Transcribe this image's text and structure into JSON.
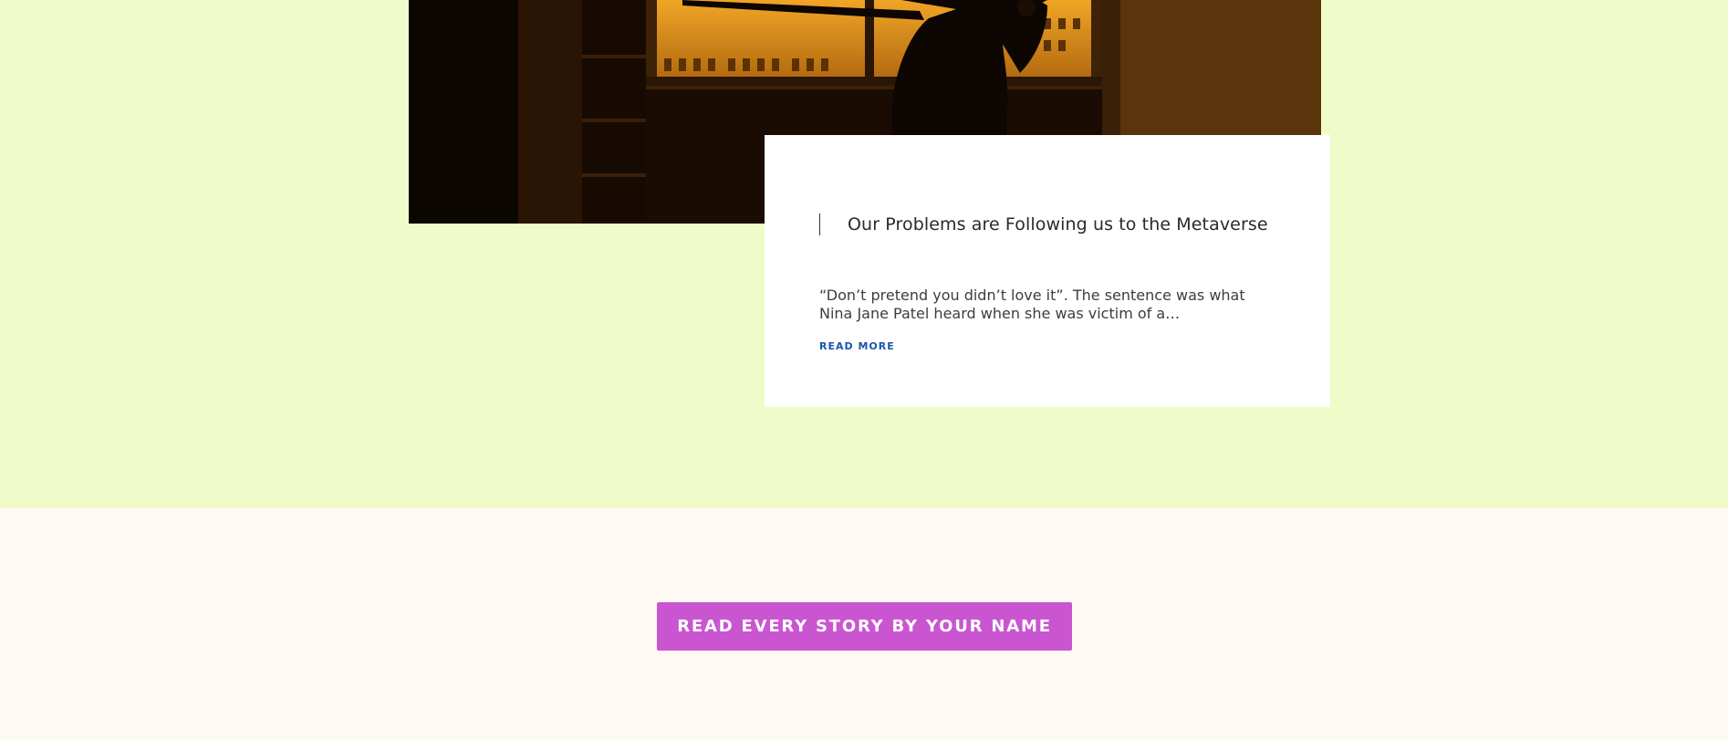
{
  "article": {
    "title": "Our Problems are Following us to the Metaverse",
    "excerpt": "“Don’t pretend you didn’t love it”. The sentence was what Nina Jane Patel heard when she was victim of a…",
    "read_more_label": "READ MORE",
    "image_description_icon": "photo-silhouette-window"
  },
  "cta": {
    "label": "READ EVERY STORY BY YOUR NAME"
  },
  "colors": {
    "top_section_bg": "#effbc8",
    "bottom_section_bg": "#fff9f3",
    "card_bg": "#ffffff",
    "link": "#1b55a8",
    "cta_bg": "#c956d0",
    "cta_text": "#ffffff"
  }
}
